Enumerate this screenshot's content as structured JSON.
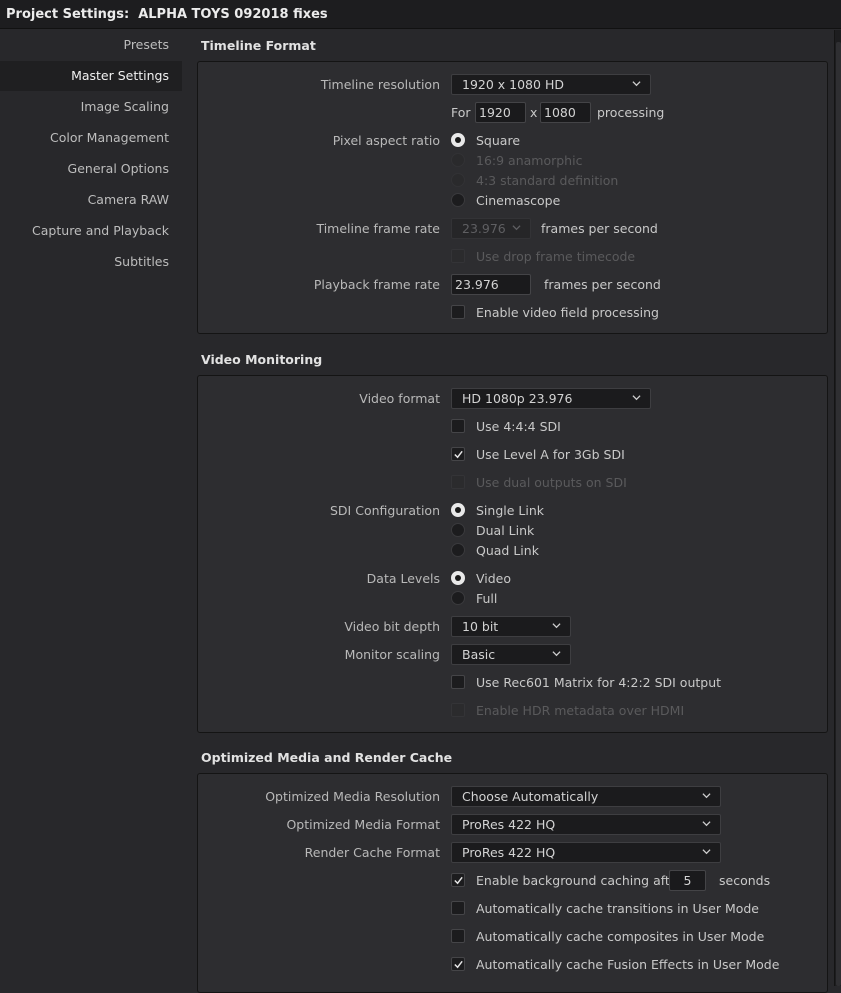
{
  "window": {
    "title": "Project Settings:  ALPHA TOYS 092018 fixes"
  },
  "sidebar": {
    "items": [
      {
        "label": "Presets"
      },
      {
        "label": "Master Settings"
      },
      {
        "label": "Image Scaling"
      },
      {
        "label": "Color Management"
      },
      {
        "label": "General Options"
      },
      {
        "label": "Camera RAW"
      },
      {
        "label": "Capture and Playback"
      },
      {
        "label": "Subtitles"
      }
    ]
  },
  "timeline_format": {
    "title": "Timeline Format",
    "resolution_label": "Timeline resolution",
    "resolution_value": "1920 x 1080 HD",
    "for_label": "For",
    "width": "1920",
    "x_label": "x",
    "height": "1080",
    "processing_label": "processing",
    "pixel_aspect_label": "Pixel aspect ratio",
    "pixel_aspect_options": [
      "Square",
      "16:9 anamorphic",
      "4:3 standard definition",
      "Cinemascope"
    ],
    "frame_rate_label": "Timeline frame rate",
    "frame_rate_value": "23.976",
    "fps_label": "frames per second",
    "drop_frame_label": "Use drop frame timecode",
    "playback_rate_label": "Playback frame rate",
    "playback_rate_value": "23.976",
    "playback_fps_label": "frames per second",
    "field_processing_label": "Enable video field processing"
  },
  "video_monitoring": {
    "title": "Video Monitoring",
    "video_format_label": "Video format",
    "video_format_value": "HD 1080p 23.976",
    "use444_label": "Use 4:4:4 SDI",
    "level_a_label": "Use Level A for 3Gb SDI",
    "dual_outputs_label": "Use dual outputs on SDI",
    "sdi_config_label": "SDI Configuration",
    "sdi_options": [
      "Single Link",
      "Dual Link",
      "Quad Link"
    ],
    "data_levels_label": "Data Levels",
    "data_levels_options": [
      "Video",
      "Full"
    ],
    "bit_depth_label": "Video bit depth",
    "bit_depth_value": "10 bit",
    "monitor_scaling_label": "Monitor scaling",
    "monitor_scaling_value": "Basic",
    "rec601_label": "Use Rec601 Matrix for 4:2:2 SDI output",
    "hdr_label": "Enable HDR metadata over HDMI"
  },
  "optimized_media": {
    "title": "Optimized Media and Render Cache",
    "resolution_label": "Optimized Media Resolution",
    "resolution_value": "Choose Automatically",
    "format_label": "Optimized Media Format",
    "format_value": "ProRes 422 HQ",
    "render_cache_label": "Render Cache Format",
    "render_cache_value": "ProRes 422 HQ",
    "bg_caching_label": "Enable background caching after",
    "bg_caching_seconds": "5",
    "seconds_label": "seconds",
    "cache_transitions_label": "Automatically cache transitions in User Mode",
    "cache_composites_label": "Automatically cache composites in User Mode",
    "cache_fusion_label": "Automatically cache Fusion Effects in User Mode"
  },
  "colors": {
    "accent_text": "#f2f2f2",
    "panel": "#2d2d30",
    "background": "#28282b"
  }
}
